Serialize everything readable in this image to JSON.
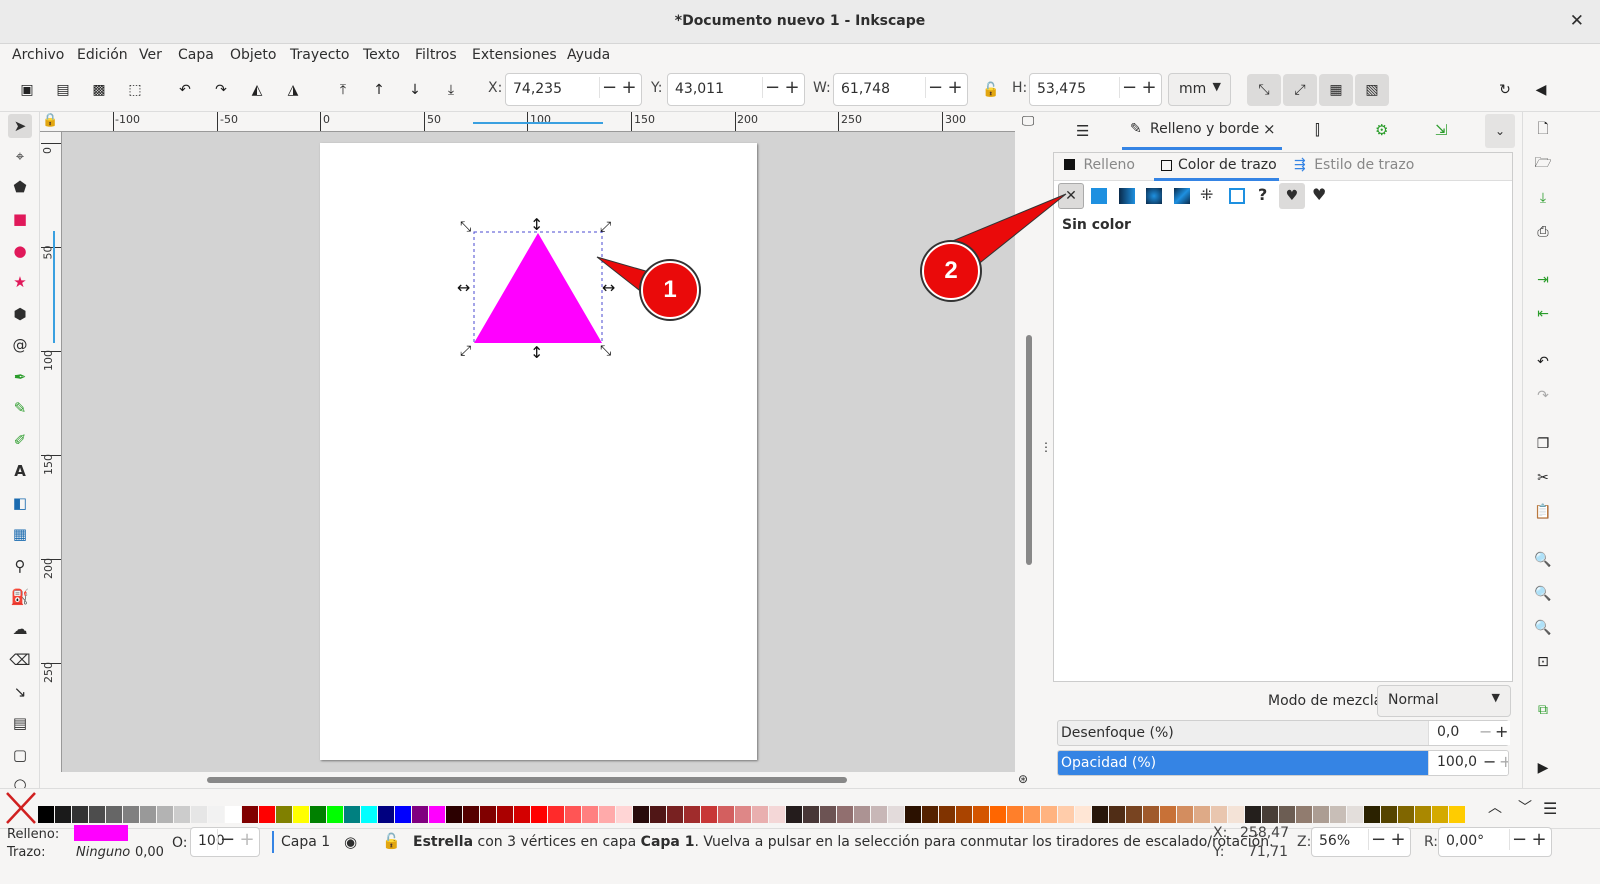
{
  "window": {
    "title": "*Documento nuevo 1 - Inkscape",
    "close_glyph": "✕"
  },
  "menu": [
    "Archivo",
    "Edición",
    "Ver",
    "Capa",
    "Objeto",
    "Trayecto",
    "Texto",
    "Filtros",
    "Extensiones",
    "Ayuda"
  ],
  "toolbar": {
    "x_label": "X:",
    "x_value": "74,235",
    "y_label": "Y:",
    "y_value": "43,011",
    "w_label": "W:",
    "w_value": "61,748",
    "h_label": "H:",
    "h_value": "53,475",
    "unit": "mm"
  },
  "ruler": {
    "h_labels": [
      "-100",
      "-50",
      "0",
      "50",
      "100",
      "150",
      "200",
      "250",
      "300"
    ],
    "v_labels": [
      "0",
      "50",
      "100",
      "150",
      "200",
      "250"
    ]
  },
  "panel": {
    "tab_label": "Relleno y borde",
    "subtabs": [
      "Relleno",
      "Color de trazo",
      "Estilo de trazo"
    ],
    "selected_paint": "Sin color",
    "blend_label": "Modo de mezcla:",
    "blend_value": "Normal",
    "blur_label": "Desenfoque (%)",
    "blur_value": "0,0",
    "opacity_label": "Opacidad (%)",
    "opacity_value": "100,0",
    "opacity_percent": 100
  },
  "callouts": [
    "1",
    "2"
  ],
  "shape": {
    "fill_color": "#ff00ff",
    "type": "triangle"
  },
  "palette": {
    "colors": [
      "#000000",
      "#1a1a1a",
      "#333333",
      "#4d4d4d",
      "#666666",
      "#808080",
      "#999999",
      "#b3b3b3",
      "#cccccc",
      "#e6e6e6",
      "#f2f2f2",
      "#ffffff",
      "#800000",
      "#ff0000",
      "#808000",
      "#ffff00",
      "#008000",
      "#00ff00",
      "#008080",
      "#00ffff",
      "#000080",
      "#0000ff",
      "#800080",
      "#ff00ff",
      "#2b0000",
      "#550000",
      "#800000",
      "#aa0000",
      "#d40000",
      "#ff0000",
      "#ff2a2a",
      "#ff5555",
      "#ff8080",
      "#ffaaaa",
      "#ffd5d5",
      "#280b0b",
      "#501616",
      "#782121",
      "#a02c2c",
      "#c83737",
      "#d35f5f",
      "#de8787",
      "#e9afaf",
      "#f4d7d7",
      "#241c1c",
      "#483737",
      "#6c5353",
      "#916f6f",
      "#ac9393",
      "#c8b7b7",
      "#e3dbdb",
      "#2b1100",
      "#552200",
      "#803300",
      "#aa4400",
      "#d45500",
      "#ff6600",
      "#ff7f2a",
      "#ff9955",
      "#ffb380",
      "#ffccaa",
      "#ffe6d5",
      "#28170b",
      "#502d16",
      "#784421",
      "#a05a2c",
      "#c87137",
      "#d38d5f",
      "#deaa87",
      "#e9c6af",
      "#f4e3d7",
      "#241f1c",
      "#483e37",
      "#6c5d53",
      "#917c6f",
      "#ac9d93",
      "#c8beb7",
      "#e3dedb",
      "#2b2200",
      "#554400",
      "#806600",
      "#aa8800",
      "#d4aa00",
      "#ffcc00"
    ]
  },
  "status": {
    "fill_label": "Relleno:",
    "fill_color": "#ff00ff",
    "stroke_label": "Trazo:",
    "stroke_value": "Ninguno",
    "stroke_width": "0,00",
    "opacity_label": "O:",
    "opacity_value": "100",
    "layer": "Capa 1",
    "msg_bold1": "Estrella",
    "msg_part1": " con 3 vértices en capa ",
    "msg_bold2": "Capa 1",
    "msg_part2": ". Vuelva a pulsar en la selección para conmutar los tiradores de escalado/rotación.",
    "cx_label": "X:",
    "cx_value": "258,47",
    "cy_label": "Y:",
    "cy_value": "71,71",
    "zoom_label": "Z:",
    "zoom_value": "56%",
    "rot_label": "R:",
    "rot_value": "0,00°"
  }
}
